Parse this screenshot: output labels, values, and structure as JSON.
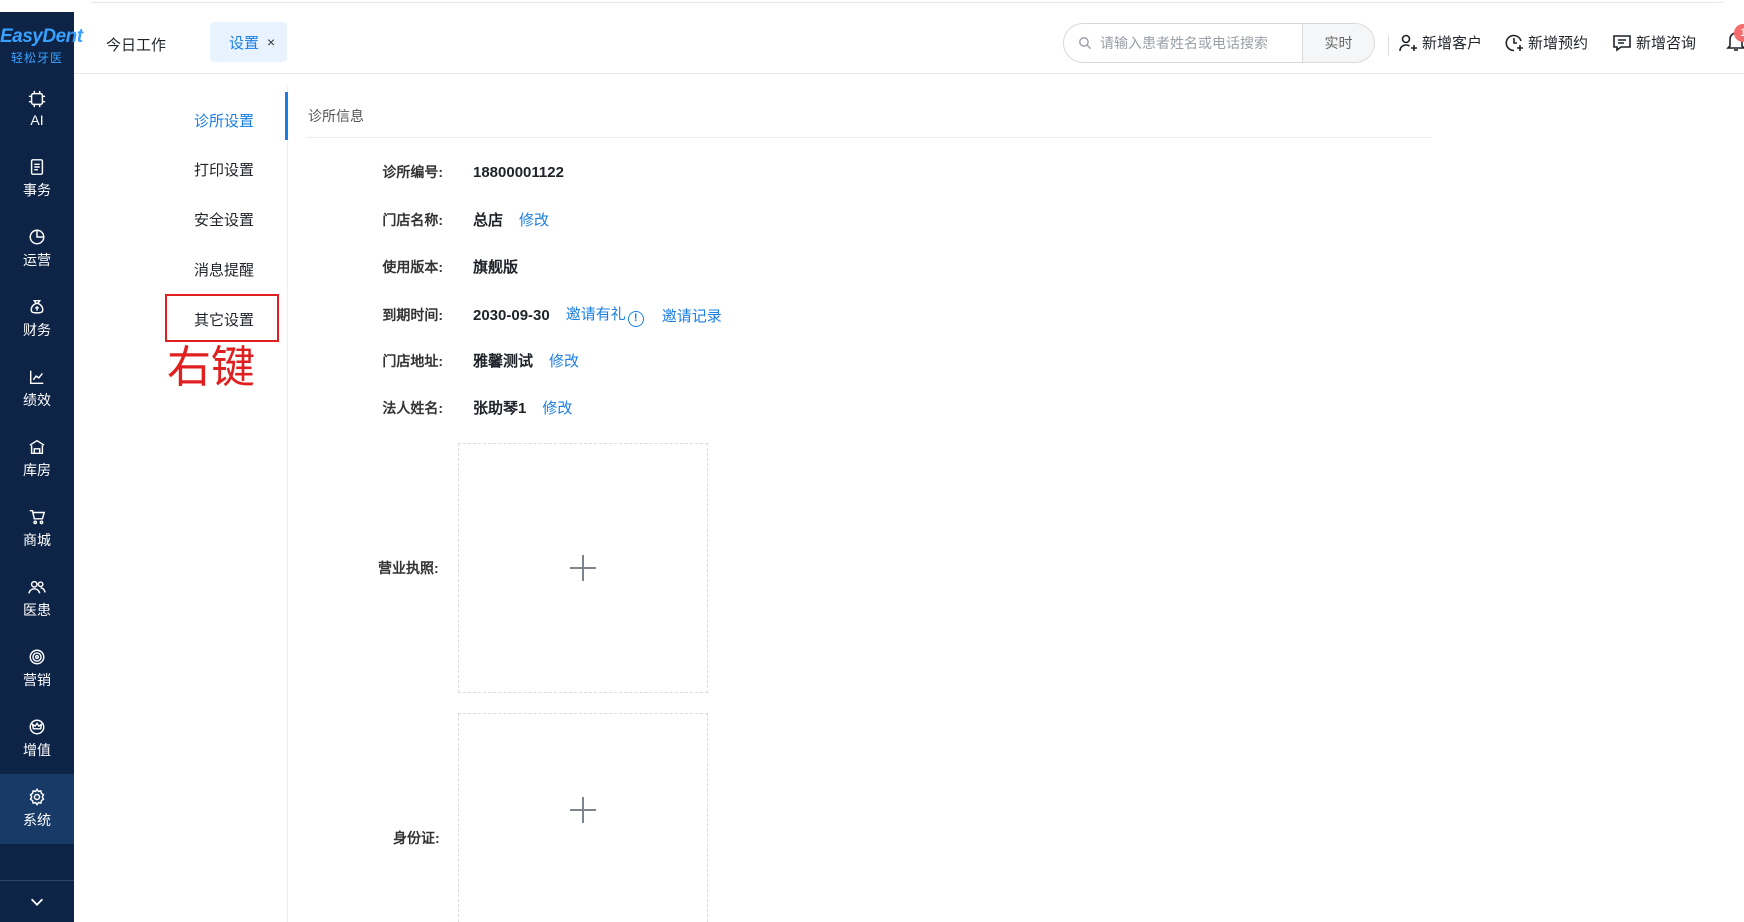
{
  "brand": {
    "logo_text": "EasyDent",
    "logo_sub": "轻松牙医"
  },
  "leftnav": {
    "items": [
      {
        "label": "AI",
        "icon": "ai-chip-icon"
      },
      {
        "label": "事务",
        "icon": "document-icon"
      },
      {
        "label": "运营",
        "icon": "pie-chart-icon"
      },
      {
        "label": "财务",
        "icon": "money-bag-icon"
      },
      {
        "label": "绩效",
        "icon": "line-chart-icon"
      },
      {
        "label": "库房",
        "icon": "warehouse-icon"
      },
      {
        "label": "商城",
        "icon": "cart-icon"
      },
      {
        "label": "医患",
        "icon": "people-icon"
      },
      {
        "label": "营销",
        "icon": "target-icon"
      },
      {
        "label": "增值",
        "icon": "crown-icon"
      },
      {
        "label": "系统",
        "icon": "gear-icon"
      }
    ],
    "active": "系统",
    "collapse_icon": "chevron-down-icon"
  },
  "header": {
    "tab_today": "今日工作",
    "tab_settings": "设置",
    "tab_close": "×",
    "search_placeholder": "请输入患者姓名或电话搜索",
    "search_mode": "实时",
    "actions": {
      "add_customer": "新增客户",
      "add_appointment": "新增预约",
      "add_consult": "新增咨询"
    },
    "notification_count": "1"
  },
  "settings_menu": {
    "items": [
      "诊所设置",
      "打印设置",
      "安全设置",
      "消息提醒",
      "其它设置"
    ],
    "active": "诊所设置"
  },
  "annotation": {
    "text": "右键",
    "color": "#e02020"
  },
  "content": {
    "section_title": "诊所信息",
    "clinic_no_label": "诊所编号:",
    "clinic_no": "18800001122",
    "store_name_label": "门店名称:",
    "store_name": "总店",
    "edit": "修改",
    "version_label": "使用版本:",
    "version": "旗舰版",
    "expire_label": "到期时间:",
    "expire": "2030-09-30",
    "invite_gift": "邀请有礼",
    "invite_record": "邀请记录",
    "address_label": "门店地址:",
    "address": "雅馨测试",
    "legal_label": "法人姓名:",
    "legal": "张助琴1",
    "license_label": "营业执照:",
    "idcard_label": "身份证:"
  },
  "colors": {
    "accent": "#1a7fe5",
    "nav_bg": "#0e2446",
    "annotation": "#e02020"
  }
}
